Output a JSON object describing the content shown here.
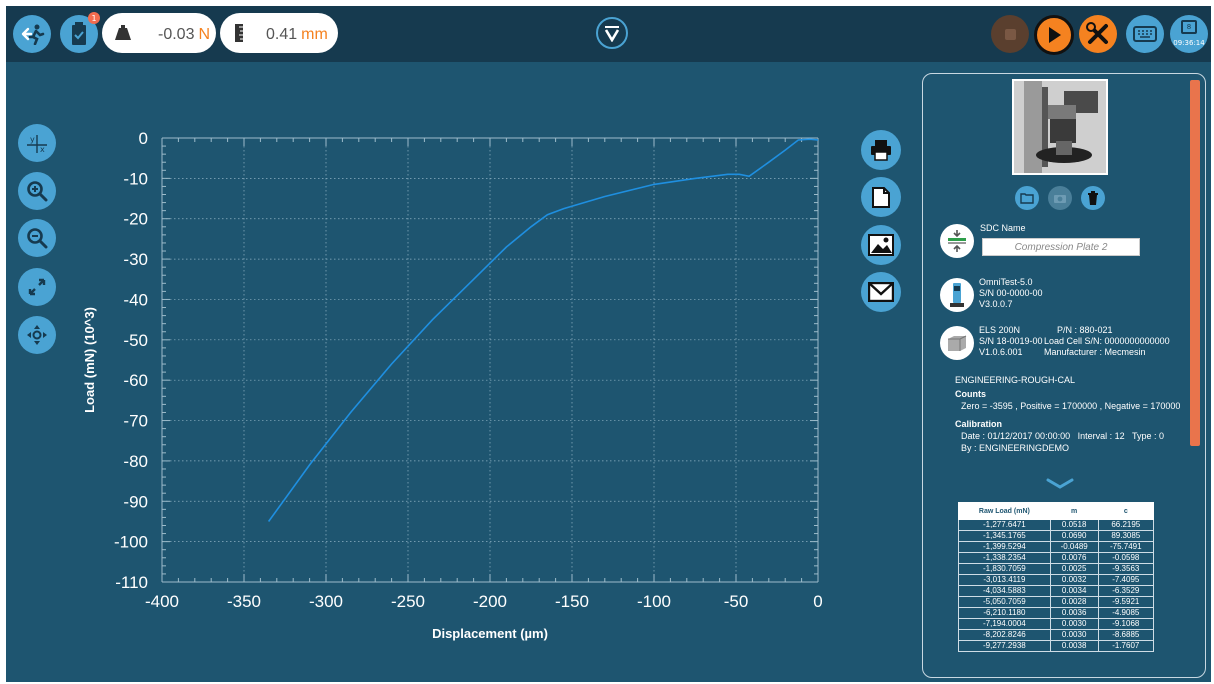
{
  "topbar": {
    "load_value": "-0.03",
    "load_unit": "N",
    "disp_value": "0.41",
    "disp_unit": "mm",
    "notification_count": "1",
    "calendar_day": "8",
    "clock": "09:36:14"
  },
  "colors": {
    "background": "#1e5570",
    "topbar": "#163a4f",
    "button": "#4aa3d3",
    "accent": "#f58220",
    "line": "#1f8fe0",
    "scrollbar": "#e9744c"
  },
  "right_panel": {
    "sdc_label": "SDC Name",
    "sdc_value": "Compression Plate 2",
    "console_lines": [
      "OmniTest-5.0",
      "S/N 00-0000-00",
      "V3.0.0.7"
    ],
    "loadcell_col1": [
      "ELS 200N",
      "S/N 18-0019-00",
      "V1.0.6.001"
    ],
    "loadcell_col2": [
      "P/N : 880-021",
      "Load Cell S/N: 0000000000000",
      "Manufacturer : Mecmesin"
    ],
    "cal_name": "ENGINEERING-ROUGH-CAL",
    "counts_heading": "Counts",
    "counts_text": "Zero = -3595 , Positive = 1700000 , Negative = 1700000",
    "calibration_heading": "Calibration",
    "calibration_line1": "Date : 01/12/2017 00:00:00   Interval : 12   Type : 0",
    "calibration_line2": "By : ENGINEERINGDEMO",
    "table": {
      "headers": [
        "Raw Load (mN)",
        "m",
        "c"
      ],
      "rows": [
        [
          "-1,277.6471",
          "0.0518",
          "66.2195"
        ],
        [
          "-1,345.1765",
          "0.0690",
          "89.3085"
        ],
        [
          "-1,399.5294",
          "-0.0489",
          "-75.7491"
        ],
        [
          "-1,338.2354",
          "0.0076",
          "-0.0598"
        ],
        [
          "-1,830.7059",
          "0.0025",
          "-9.3563"
        ],
        [
          "-3,013.4119",
          "0.0032",
          "-7.4095"
        ],
        [
          "-4,034.5883",
          "0.0034",
          "-6.3529"
        ],
        [
          "-5,050.7059",
          "0.0028",
          "-9.5921"
        ],
        [
          "-6,210.1180",
          "0.0036",
          "-4.9085"
        ],
        [
          "-7,194.0004",
          "0.0030",
          "-9.1068"
        ],
        [
          "-8,202.8246",
          "0.0030",
          "-8.6885"
        ],
        [
          "-9,277.2938",
          "0.0038",
          "-1.7607"
        ]
      ]
    }
  },
  "chart_data": {
    "type": "line",
    "xlabel": "Displacement (µm)",
    "ylabel": "Load (mN) (10^3)",
    "xlim": [
      -400,
      0
    ],
    "ylim": [
      -110,
      0
    ],
    "xticks": [
      -400,
      -350,
      -300,
      -250,
      -200,
      -150,
      -100,
      -50,
      0
    ],
    "yticks": [
      0,
      -10,
      -20,
      -30,
      -40,
      -50,
      -60,
      -70,
      -80,
      -90,
      -100,
      -110
    ],
    "grid": true,
    "x": [
      -335,
      -310,
      -285,
      -260,
      -235,
      -210,
      -190,
      -175,
      -165,
      -155,
      -130,
      -100,
      -75,
      -55,
      -48,
      -42,
      -30,
      -20,
      -12,
      -5,
      0
    ],
    "y": [
      -95,
      -81,
      -68,
      -56,
      -45,
      -35,
      -27,
      -22,
      -19,
      -17.5,
      -14.5,
      -11.5,
      -10,
      -9,
      -9,
      -9.5,
      -6,
      -3,
      -0.5,
      -0.3,
      -0.5
    ]
  }
}
